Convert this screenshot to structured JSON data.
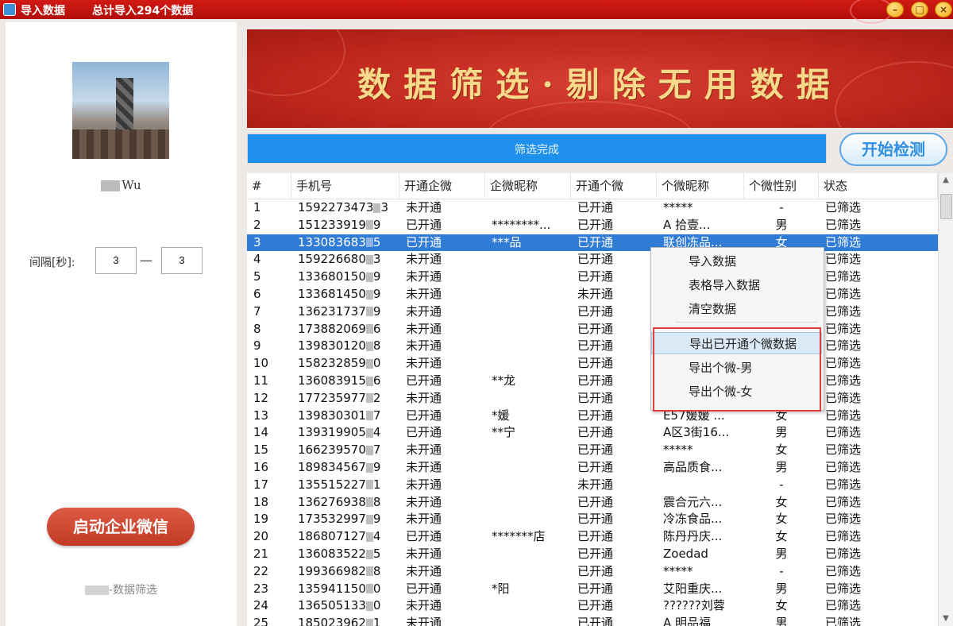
{
  "window": {
    "title": "导入数据",
    "summary": "总计导入294个数据",
    "minimize_icon": "minimize-icon",
    "maximize_icon": "maximize-icon",
    "close_icon": "close-icon"
  },
  "sidebar": {
    "username": "Wu",
    "interval_label": "间隔[秒]:",
    "interval_min": "3",
    "interval_dash": "—",
    "interval_max": "3",
    "start_button": "启动企业微信",
    "footer": "-数据筛选"
  },
  "banner": {
    "title": "数据筛选·剔除无用数据"
  },
  "progress": {
    "text": "筛选完成",
    "fill": 1.0
  },
  "check_button": "开始检测",
  "table": {
    "headers": [
      "#",
      "手机号",
      "开通企微",
      "企微昵称",
      "开通个微",
      "个微昵称",
      "个微性别",
      "状态"
    ],
    "selected_row": 3,
    "rows": [
      {
        "n": "1",
        "phone_a": "1592273473",
        "phone_b": "3",
        "qw": "未开通",
        "qwnick": "",
        "gw": "已开通",
        "gwnick": "*****",
        "sex": "-",
        "status": "已筛选"
      },
      {
        "n": "2",
        "phone_a": "151233919",
        "phone_b": "9",
        "qw": "已开通",
        "qwnick": "********...",
        "gw": "已开通",
        "gwnick": "A 拾壹...",
        "sex": "男",
        "status": "已筛选"
      },
      {
        "n": "3",
        "phone_a": "133083683",
        "phone_b": "5",
        "qw": "已开通",
        "qwnick": "***品",
        "gw": "已开通",
        "gwnick": "联创冻品...",
        "sex": "女",
        "status": "已筛选"
      },
      {
        "n": "4",
        "phone_a": "159226680",
        "phone_b": "3",
        "qw": "未开通",
        "qwnick": "",
        "gw": "已开通",
        "gwnick": "",
        "sex": "",
        "status": "已筛选"
      },
      {
        "n": "5",
        "phone_a": "133680150",
        "phone_b": "9",
        "qw": "未开通",
        "qwnick": "",
        "gw": "已开通",
        "gwnick": "",
        "sex": "",
        "status": "已筛选"
      },
      {
        "n": "6",
        "phone_a": "133681450",
        "phone_b": "9",
        "qw": "未开通",
        "qwnick": "",
        "gw": "未开通",
        "gwnick": "",
        "sex": "",
        "status": "已筛选"
      },
      {
        "n": "7",
        "phone_a": "136231737",
        "phone_b": "9",
        "qw": "未开通",
        "qwnick": "",
        "gw": "已开通",
        "gwnick": "",
        "sex": "",
        "status": "已筛选"
      },
      {
        "n": "8",
        "phone_a": "173882069",
        "phone_b": "6",
        "qw": "未开通",
        "qwnick": "",
        "gw": "已开通",
        "gwnick": "",
        "sex": "",
        "status": "已筛选"
      },
      {
        "n": "9",
        "phone_a": "139830120",
        "phone_b": "8",
        "qw": "未开通",
        "qwnick": "",
        "gw": "已开通",
        "gwnick": "",
        "sex": "",
        "status": "已筛选"
      },
      {
        "n": "10",
        "phone_a": "158232859",
        "phone_b": "0",
        "qw": "未开通",
        "qwnick": "",
        "gw": "已开通",
        "gwnick": "",
        "sex": "",
        "status": "已筛选"
      },
      {
        "n": "11",
        "phone_a": "136083915",
        "phone_b": "6",
        "qw": "已开通",
        "qwnick": "**龙",
        "gw": "已开通",
        "gwnick": "",
        "sex": "",
        "status": "已筛选"
      },
      {
        "n": "12",
        "phone_a": "177235977",
        "phone_b": "2",
        "qw": "未开通",
        "qwnick": "",
        "gw": "已开通",
        "gwnick": "",
        "sex": "",
        "status": "已筛选"
      },
      {
        "n": "13",
        "phone_a": "139830301",
        "phone_b": "7",
        "qw": "已开通",
        "qwnick": "*媛",
        "gw": "已开通",
        "gwnick": "E57媛媛 ...",
        "sex": "女",
        "status": "已筛选"
      },
      {
        "n": "14",
        "phone_a": "139319905",
        "phone_b": "4",
        "qw": "已开通",
        "qwnick": "**宁",
        "gw": "已开通",
        "gwnick": "A区3街16...",
        "sex": "男",
        "status": "已筛选"
      },
      {
        "n": "15",
        "phone_a": "166239570",
        "phone_b": "7",
        "qw": "未开通",
        "qwnick": "",
        "gw": "已开通",
        "gwnick": "*****",
        "sex": "女",
        "status": "已筛选"
      },
      {
        "n": "16",
        "phone_a": "189834567",
        "phone_b": "9",
        "qw": "未开通",
        "qwnick": "",
        "gw": "已开通",
        "gwnick": "高品质食...",
        "sex": "男",
        "status": "已筛选"
      },
      {
        "n": "17",
        "phone_a": "135515227",
        "phone_b": "1",
        "qw": "未开通",
        "qwnick": "",
        "gw": "未开通",
        "gwnick": "",
        "sex": "-",
        "status": "已筛选"
      },
      {
        "n": "18",
        "phone_a": "136276938",
        "phone_b": "8",
        "qw": "未开通",
        "qwnick": "",
        "gw": "已开通",
        "gwnick": "震合元六...",
        "sex": "女",
        "status": "已筛选"
      },
      {
        "n": "19",
        "phone_a": "173532997",
        "phone_b": "9",
        "qw": "未开通",
        "qwnick": "",
        "gw": "已开通",
        "gwnick": "冷冻食品...",
        "sex": "女",
        "status": "已筛选"
      },
      {
        "n": "20",
        "phone_a": "186807127",
        "phone_b": "4",
        "qw": "已开通",
        "qwnick": "*******店",
        "gw": "已开通",
        "gwnick": "陈丹丹庆...",
        "sex": "女",
        "status": "已筛选"
      },
      {
        "n": "21",
        "phone_a": "136083522",
        "phone_b": "5",
        "qw": "未开通",
        "qwnick": "",
        "gw": "已开通",
        "gwnick": "Zoedad",
        "sex": "男",
        "status": "已筛选"
      },
      {
        "n": "22",
        "phone_a": "199366982",
        "phone_b": "8",
        "qw": "未开通",
        "qwnick": "",
        "gw": "已开通",
        "gwnick": "*****",
        "sex": "-",
        "status": "已筛选"
      },
      {
        "n": "23",
        "phone_a": "135941150",
        "phone_b": "0",
        "qw": "已开通",
        "qwnick": "*阳",
        "gw": "已开通",
        "gwnick": "艾阳重庆...",
        "sex": "男",
        "status": "已筛选"
      },
      {
        "n": "24",
        "phone_a": "136505133",
        "phone_b": "0",
        "qw": "未开通",
        "qwnick": "",
        "gw": "已开通",
        "gwnick": "??????刘蓉",
        "sex": "女",
        "status": "已筛选"
      },
      {
        "n": "25",
        "phone_a": "185023962",
        "phone_b": "1",
        "qw": "未开通",
        "qwnick": "",
        "gw": "已开通",
        "gwnick": "A 明品福",
        "sex": "男",
        "status": "已筛选"
      }
    ]
  },
  "context_menu": {
    "items": [
      "导入数据",
      "表格导入数据",
      "清空数据",
      "导出已开通个微数据",
      "导出个微-男",
      "导出个微-女"
    ],
    "hover_index": 3
  },
  "colors": {
    "title_bar": "#c4140f",
    "selection": "#2f7bd6",
    "progress": "#1f90ec",
    "start_button": "#cc4530",
    "highlight_box": "#e04040"
  }
}
